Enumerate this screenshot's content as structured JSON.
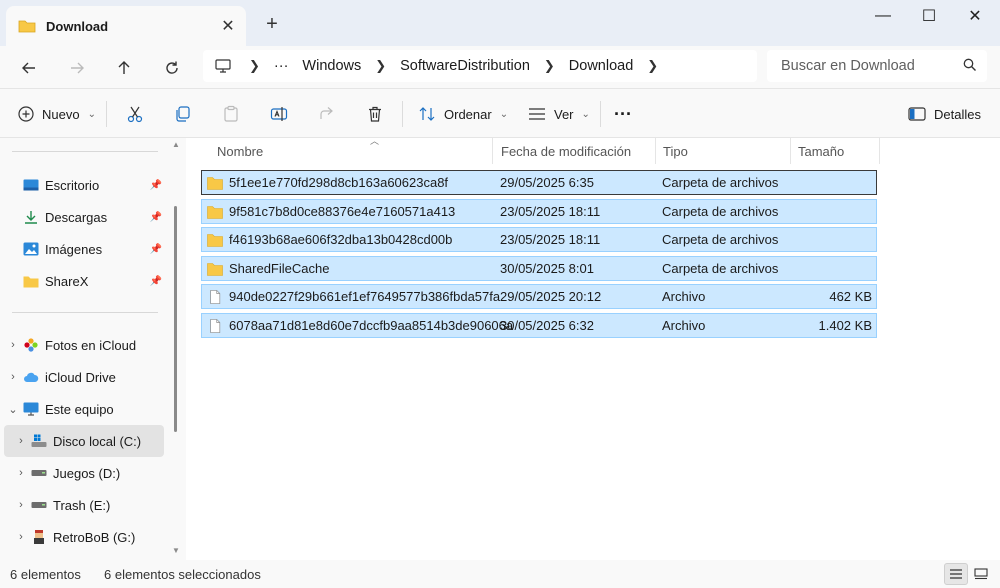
{
  "window": {
    "tab_title": "Download",
    "tab_close": "✕",
    "new_tab": "+",
    "minimize": "—",
    "maximize": "☐",
    "close": "✕"
  },
  "address": {
    "more": "···",
    "crumbs": [
      "Windows",
      "SoftwareDistribution",
      "Download"
    ],
    "search_placeholder": "Buscar en Download"
  },
  "toolbar": {
    "new_label": "Nuevo",
    "sort_label": "Ordenar",
    "view_label": "Ver",
    "more": "···",
    "details_label": "Detalles"
  },
  "sidebar": {
    "quick": [
      {
        "label": "Escritorio",
        "icon": "desktop-icon"
      },
      {
        "label": "Descargas",
        "icon": "download-icon"
      },
      {
        "label": "Imágenes",
        "icon": "pictures-icon"
      },
      {
        "label": "ShareX",
        "icon": "folder-icon"
      }
    ],
    "tree": [
      {
        "label": "Fotos en iCloud",
        "icon": "icloud-photos-icon",
        "expand": "›"
      },
      {
        "label": "iCloud Drive",
        "icon": "icloud-drive-icon",
        "expand": "›"
      },
      {
        "label": "Este equipo",
        "icon": "this-pc-icon",
        "expand": "⌄"
      },
      {
        "label": "Disco local (C:)",
        "icon": "windows-drive-icon",
        "expand": "›"
      },
      {
        "label": "Juegos (D:)",
        "icon": "drive-icon",
        "expand": "›"
      },
      {
        "label": "Trash (E:)",
        "icon": "drive-icon",
        "expand": "›"
      },
      {
        "label": "RetroBoB (G:)",
        "icon": "retrobob-drive-icon",
        "expand": "›"
      }
    ]
  },
  "table": {
    "columns": [
      "Nombre",
      "Fecha de modificación",
      "Tipo",
      "Tamaño"
    ],
    "rows": [
      {
        "name": "5f1ee1e770fd298d8cb163a60623ca8f",
        "date": "29/05/2025 6:35",
        "type": "Carpeta de archivos",
        "size": "",
        "kind": "folder"
      },
      {
        "name": "9f581c7b8d0ce88376e4e7160571a413",
        "date": "23/05/2025 18:11",
        "type": "Carpeta de archivos",
        "size": "",
        "kind": "folder"
      },
      {
        "name": "f46193b68ae606f32dba13b0428cd00b",
        "date": "23/05/2025 18:11",
        "type": "Carpeta de archivos",
        "size": "",
        "kind": "folder"
      },
      {
        "name": "SharedFileCache",
        "date": "30/05/2025 8:01",
        "type": "Carpeta de archivos",
        "size": "",
        "kind": "folder"
      },
      {
        "name": "940de0227f29b661ef1ef7649577b386fbda57fa",
        "date": "29/05/2025 20:12",
        "type": "Archivo",
        "size": "462 KB",
        "kind": "file"
      },
      {
        "name": "6078aa71d81e8d60e7dccfb9aa8514b3de90606a",
        "date": "30/05/2025 6:32",
        "type": "Archivo",
        "size": "1.402 KB",
        "kind": "file"
      }
    ]
  },
  "status": {
    "count": "6 elementos",
    "selected": "6 elementos seleccionados"
  },
  "colors": {
    "selection_fill": "#cce8ff",
    "selection_border": "#99d1ff",
    "folder_yellow": "#f8c846"
  }
}
